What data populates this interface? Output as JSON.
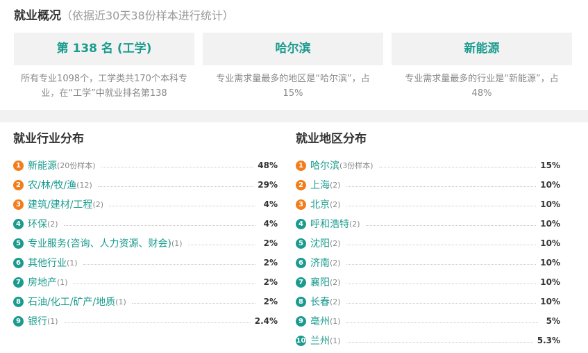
{
  "overview": {
    "title": "就业概况",
    "subtitle": "（依据近30天38份样本进行统计）",
    "cards": [
      {
        "value": "第 138 名 (工学)",
        "desc_line1": "所有专业1098个，工学类共170个本科专",
        "desc_line2": "业，在“工学”中就业排名第138"
      },
      {
        "value": "哈尔滨",
        "desc_line1": "专业需求量最多的地区是“哈尔滨”，占",
        "desc_line2": "15%"
      },
      {
        "value": "新能源",
        "desc_line1": "专业需求量最多的行业是“新能源”，占",
        "desc_line2": "48%"
      }
    ]
  },
  "industry": {
    "title": "就业行业分布",
    "items": [
      {
        "rank": "1",
        "name": "新能源",
        "count": "(20份样本)",
        "pct": "48%"
      },
      {
        "rank": "2",
        "name": "农/林/牧/渔",
        "count": "(12)",
        "pct": "29%"
      },
      {
        "rank": "3",
        "name": "建筑/建材/工程",
        "count": "(2)",
        "pct": "4%"
      },
      {
        "rank": "4",
        "name": "环保",
        "count": "(2)",
        "pct": "4%"
      },
      {
        "rank": "5",
        "name": "专业服务(咨询、人力资源、财会)",
        "count": "(1)",
        "pct": "2%"
      },
      {
        "rank": "6",
        "name": "其他行业",
        "count": "(1)",
        "pct": "2%"
      },
      {
        "rank": "7",
        "name": "房地产",
        "count": "(1)",
        "pct": "2%"
      },
      {
        "rank": "8",
        "name": "石油/化工/矿产/地质",
        "count": "(1)",
        "pct": "2%"
      },
      {
        "rank": "9",
        "name": "银行",
        "count": "(1)",
        "pct": "2.4%"
      }
    ]
  },
  "region": {
    "title": "就业地区分布",
    "items": [
      {
        "rank": "1",
        "name": "哈尔滨",
        "count": "(3份样本)",
        "pct": "15%"
      },
      {
        "rank": "2",
        "name": "上海",
        "count": "(2)",
        "pct": "10%"
      },
      {
        "rank": "3",
        "name": "北京",
        "count": "(2)",
        "pct": "10%"
      },
      {
        "rank": "4",
        "name": "呼和浩特",
        "count": "(2)",
        "pct": "10%"
      },
      {
        "rank": "5",
        "name": "沈阳",
        "count": "(2)",
        "pct": "10%"
      },
      {
        "rank": "6",
        "name": "济南",
        "count": "(2)",
        "pct": "10%"
      },
      {
        "rank": "7",
        "name": "襄阳",
        "count": "(2)",
        "pct": "10%"
      },
      {
        "rank": "8",
        "name": "长春",
        "count": "(2)",
        "pct": "10%"
      },
      {
        "rank": "9",
        "name": "亳州",
        "count": "(1)",
        "pct": "5%"
      },
      {
        "rank": "10",
        "name": "兰州",
        "count": "(1)",
        "pct": "5.3%"
      }
    ]
  },
  "colors": {
    "accent": "#1a9b8e",
    "top_badge": "#f27d1a",
    "rest_badge": "#1a9b8e"
  }
}
